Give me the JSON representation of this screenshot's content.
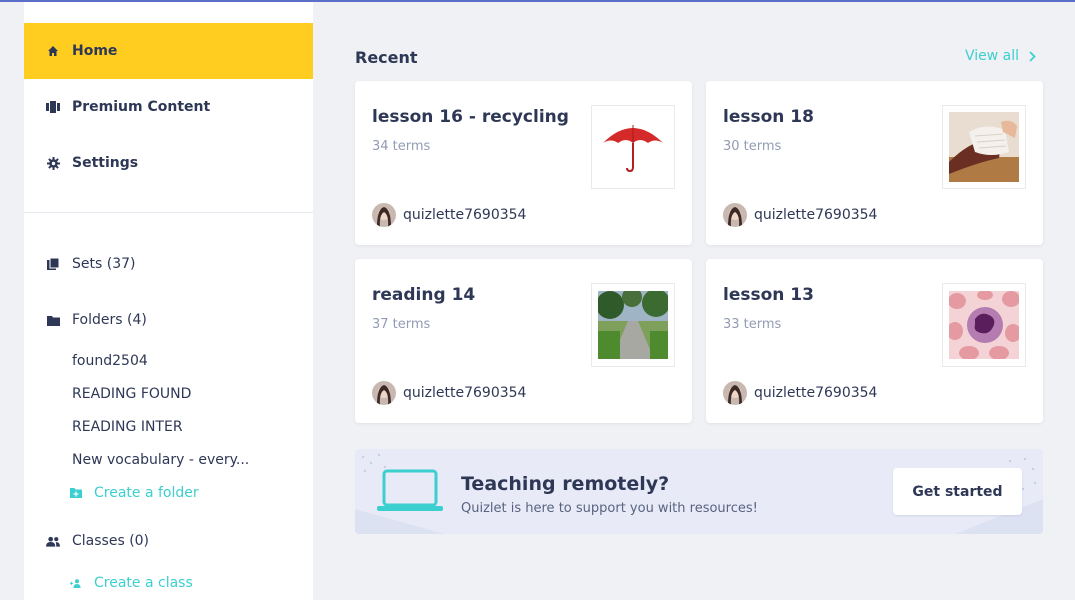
{
  "sidebar": {
    "nav": [
      {
        "label": "Home",
        "icon": "home-icon"
      },
      {
        "label": "Premium Content",
        "icon": "premium-content-icon"
      },
      {
        "label": "Settings",
        "icon": "gear-icon"
      }
    ],
    "sets_label": "Sets (37)",
    "folders_label": "Folders (4)",
    "folders": [
      "found2504",
      "READING FOUND",
      "READING INTER",
      "New vocabulary - every..."
    ],
    "create_folder_label": "Create a folder",
    "classes_label": "Classes (0)",
    "create_class_label": "Create a class"
  },
  "main": {
    "recent_title": "Recent",
    "view_all_label": "View all",
    "cards": [
      {
        "title": "lesson 16 - recycling",
        "terms": "34 terms",
        "user": "quizlette7690354",
        "image": "umbrella-image"
      },
      {
        "title": "lesson 18",
        "terms": "30 terms",
        "user": "quizlette7690354",
        "image": "bandaged-hand-image"
      },
      {
        "title": "reading 14",
        "terms": "37 terms",
        "user": "quizlette7690354",
        "image": "sidewalk-image"
      },
      {
        "title": "lesson 13",
        "terms": "33 terms",
        "user": "quizlette7690354",
        "image": "blood-cell-image"
      }
    ]
  },
  "banner": {
    "title": "Teaching remotely?",
    "subtitle": "Quizlet is here to support you with resources!",
    "button_label": "Get started"
  },
  "colors": {
    "active_nav": "#ffcd1f",
    "accent_link": "#3ccfcf",
    "text_primary": "#2e3856",
    "text_secondary": "#939bb4",
    "background": "#f0f1f4"
  }
}
